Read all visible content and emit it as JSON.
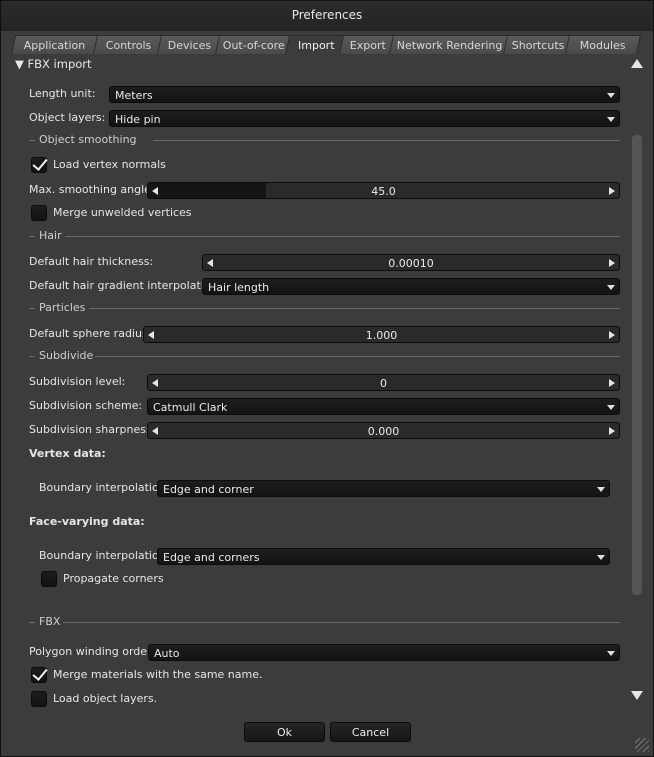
{
  "window": {
    "title": "Preferences"
  },
  "tabs": [
    "Application",
    "Controls",
    "Devices",
    "Out-of-core",
    "Import",
    "Export",
    "Network Rendering",
    "Shortcuts",
    "Modules"
  ],
  "active_tab": "Import",
  "section": {
    "title": "FBX import"
  },
  "fields": {
    "length_unit": {
      "label": "Length unit:",
      "value": "Meters"
    },
    "object_layers": {
      "label": "Object layers:",
      "value": "Hide pin"
    },
    "object_smoothing_group": "Object smoothing",
    "load_vertex_normals": {
      "label": "Load vertex normals",
      "checked": true
    },
    "max_smoothing_angle": {
      "label": "Max. smoothing angle:",
      "value": "45.0",
      "fill": 0.25
    },
    "merge_unwelded": {
      "label": "Merge unwelded vertices",
      "checked": false
    },
    "hair_group": "Hair",
    "default_hair_thickness": {
      "label": "Default hair thickness:",
      "value": "0.00010",
      "fill": 0
    },
    "default_hair_gradient": {
      "label": "Default hair gradient interpolation:",
      "value": "Hair length"
    },
    "particles_group": "Particles",
    "default_sphere_radius": {
      "label": "Default sphere radius:",
      "value": "1.000",
      "fill": 0
    },
    "subdivide_group": "Subdivide",
    "subdivision_level": {
      "label": "Subdivision level:",
      "value": "0",
      "fill": 0
    },
    "subdivision_scheme": {
      "label": "Subdivision scheme:",
      "value": "Catmull Clark"
    },
    "subdivision_sharpness": {
      "label": "Subdivision sharpness:",
      "value": "0.000",
      "fill": 0
    },
    "vertex_data": {
      "label": "Vertex data:"
    },
    "vertex_boundary": {
      "label": "Boundary interpolation:",
      "value": "Edge and corner"
    },
    "face_varying_data": {
      "label": "Face-varying data:"
    },
    "face_boundary": {
      "label": "Boundary interpolation:",
      "value": "Edge and corners"
    },
    "propagate_corners": {
      "label": "Propagate corners",
      "checked": false
    },
    "fbx_group": "FBX",
    "polygon_winding_order": {
      "label": "Polygon winding order:",
      "value": "Auto"
    },
    "merge_materials": {
      "label": "Merge materials with the same name.",
      "checked": true
    },
    "load_object_layers": {
      "label": "Load object layers.",
      "checked": false
    }
  },
  "buttons": {
    "ok": "Ok",
    "cancel": "Cancel"
  }
}
